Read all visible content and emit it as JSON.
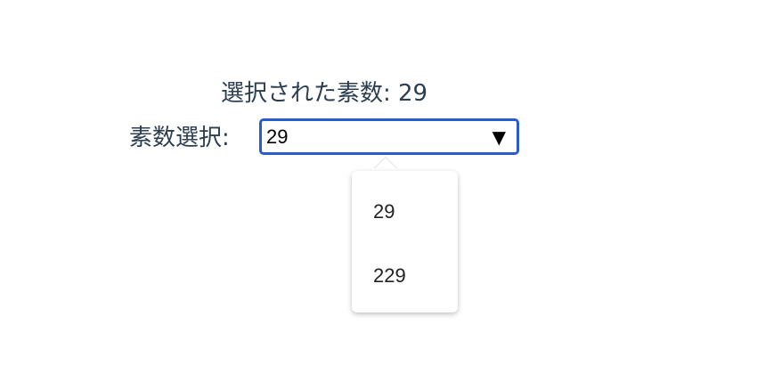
{
  "title": {
    "label": "選択された素数:",
    "value": "29"
  },
  "select": {
    "label": "素数選択:",
    "value": "29",
    "arrow": "▼"
  },
  "options": [
    "29",
    "229"
  ],
  "colors": {
    "text": "#2c3e50",
    "focus_border": "#2a5bd0"
  }
}
